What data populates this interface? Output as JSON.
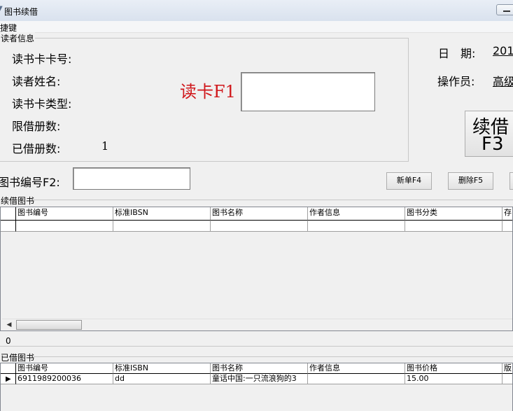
{
  "window": {
    "title": "图书续借",
    "icon": "book-app-icon"
  },
  "menu": {
    "shortcut": "快捷键"
  },
  "reader_info": {
    "group_title": "读者信息",
    "card_no_label": "读书卡卡号:",
    "name_label": "读者姓名:",
    "card_type_label": "读书卡类型:",
    "limit_label": "限借册数:",
    "borrowed_label": "已借册数:",
    "borrowed_value": "1",
    "read_card_label": "读卡F1",
    "read_card_value": ""
  },
  "side": {
    "date_label": "日　期:",
    "date_value": "201",
    "operator_label": "操作员:",
    "operator_value": "高级",
    "renew_button_line1": "续借",
    "renew_button_line2": "F3"
  },
  "book_input": {
    "label": "图书编号F2:",
    "value": ""
  },
  "buttons": {
    "new_label": "新单F4",
    "delete_label": "删除F5"
  },
  "renew_grid": {
    "group_title": "续借图书",
    "columns": [
      "图书编号",
      "标准IBSN",
      "图书名称",
      "作者信息",
      "图书分类",
      "存"
    ],
    "rows": [
      [
        "",
        "",
        "",
        "",
        "",
        ""
      ]
    ],
    "count": "0"
  },
  "borrowed_grid": {
    "group_title": "已借图书",
    "columns": [
      "图书编号",
      "标准ISBN",
      "图书名称",
      "作者信息",
      "图书价格",
      "版"
    ],
    "rows": [
      [
        "6911989200036",
        "dd",
        "童话中国:一只流浪狗的3",
        "",
        "15.00",
        ""
      ]
    ]
  },
  "colors": {
    "accent_red": "#d0171b"
  }
}
